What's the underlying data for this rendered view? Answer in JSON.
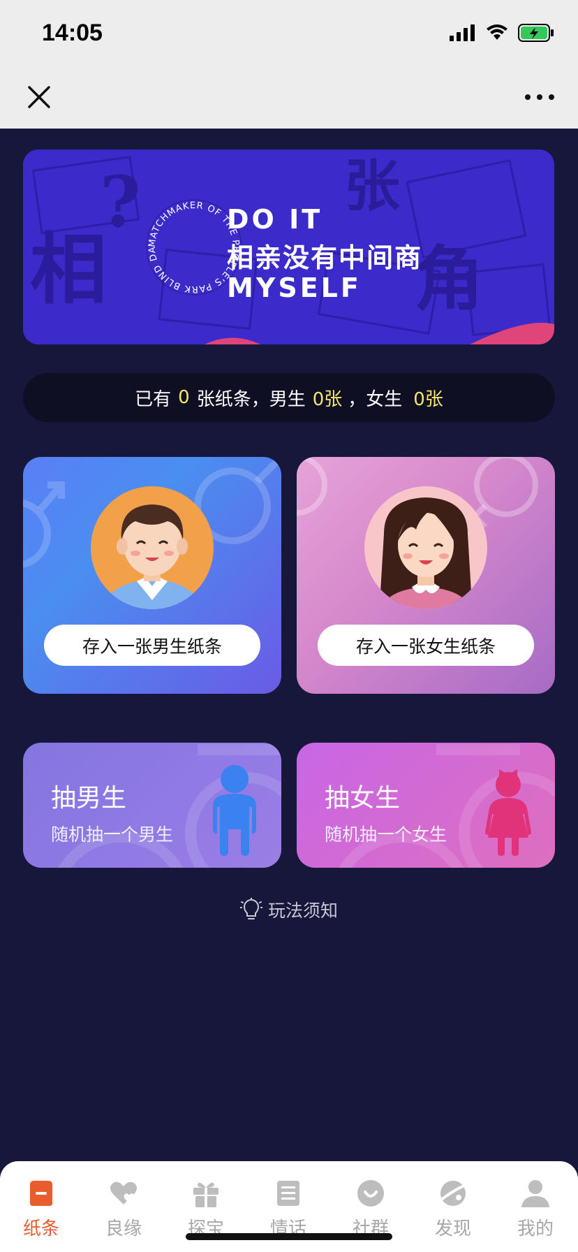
{
  "status": {
    "time": "14:05"
  },
  "banner": {
    "line1": "DO IT",
    "line2": "相亲没有中间商",
    "line3": "MYSELF",
    "ring_text": "MATCHMAKER OF THE PEOPLE'S PARK BLIND DATING CORNER PREDESTINED "
  },
  "stats": {
    "prefix": "已有",
    "total": "0",
    "mid1": "张纸条，男生",
    "male": "0张",
    "mid2": "，女生",
    "female": "0张"
  },
  "cards": {
    "male_button": "存入一张男生纸条",
    "female_button": "存入一张女生纸条"
  },
  "draw": {
    "male_title": "抽男生",
    "male_sub": "随机抽一个男生",
    "female_title": "抽女生",
    "female_sub": "随机抽一个女生"
  },
  "rules": {
    "label": "玩法须知"
  },
  "tabs": [
    {
      "label": "纸条",
      "icon": "note-icon",
      "active": true
    },
    {
      "label": "良缘",
      "icon": "hearts-icon"
    },
    {
      "label": "探宝",
      "icon": "gift-icon"
    },
    {
      "label": "情话",
      "icon": "list-icon"
    },
    {
      "label": "社群",
      "icon": "smile-icon"
    },
    {
      "label": "发现",
      "icon": "planet-icon"
    },
    {
      "label": "我的",
      "icon": "person-icon"
    }
  ],
  "colors": {
    "accent": "#ea5b2d",
    "highlight": "#f5e66b",
    "background": "#16173a",
    "banner": "#3a2bc9",
    "tab_inactive": "#a7a7a7"
  }
}
